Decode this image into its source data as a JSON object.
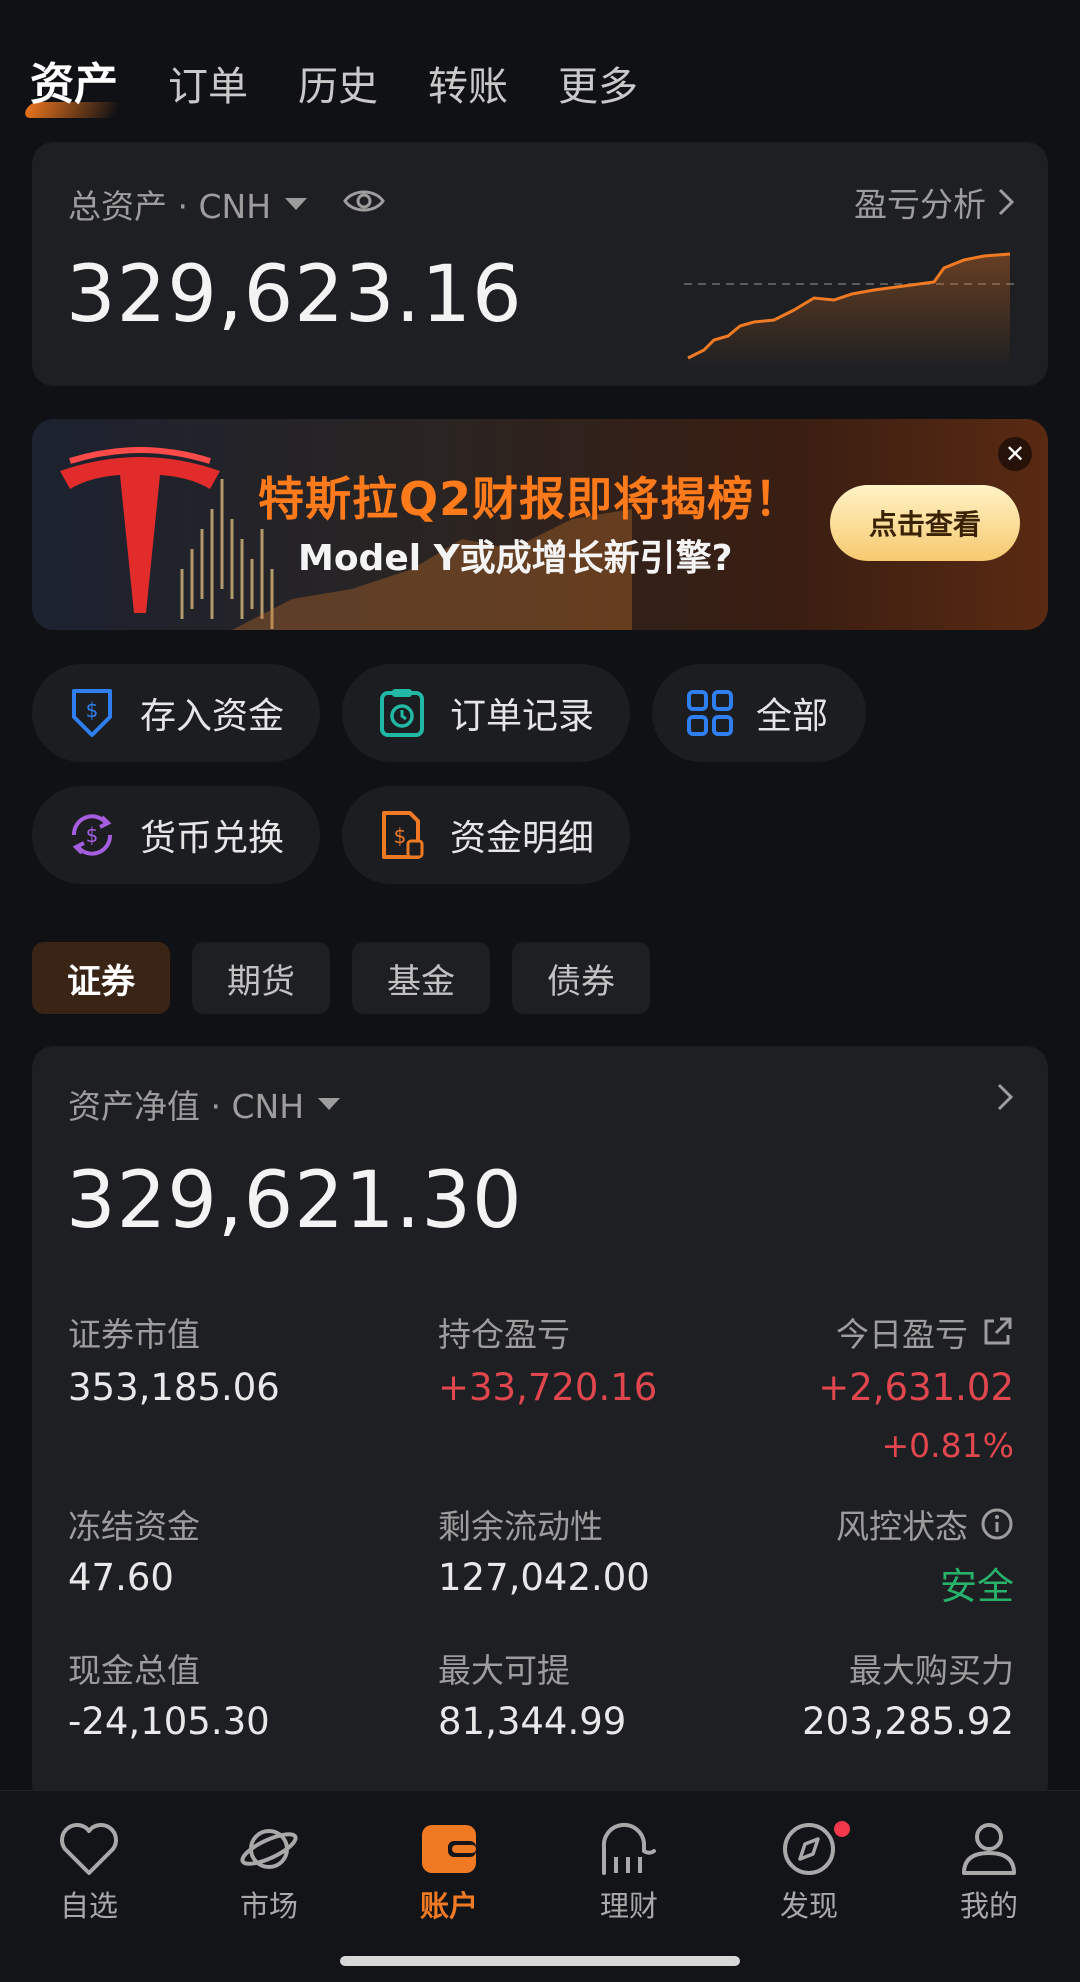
{
  "top_tabs": [
    "资产",
    "订单",
    "历史",
    "转账",
    "更多"
  ],
  "total": {
    "label": "总资产 · CNH",
    "value": "329,623.16",
    "pnl_link": "盈亏分析",
    "sparkline_color": "#f07a24"
  },
  "banner": {
    "title": "特斯拉Q2财报即将揭榜！",
    "subtitle": "Model Y或成增长新引擎?",
    "button": "点击查看"
  },
  "quick_actions": [
    {
      "label": "存入资金",
      "icon": "deposit-icon",
      "color": "#2f7ff0"
    },
    {
      "label": "订单记录",
      "icon": "order-record-icon",
      "color": "#21b8a5"
    },
    {
      "label": "全部",
      "icon": "grid-icon",
      "color": "#2f7ff0"
    },
    {
      "label": "货币兑换",
      "icon": "currency-exchange-icon",
      "color": "#a65ee0"
    },
    {
      "label": "资金明细",
      "icon": "fund-detail-icon",
      "color": "#f07a24"
    }
  ],
  "segments": [
    "证券",
    "期货",
    "基金",
    "债券"
  ],
  "net": {
    "label": "资产净值 · CNH",
    "value": "329,621.30",
    "stats": {
      "market_value": {
        "label": "证券市值",
        "value": "353,185.06"
      },
      "position_pnl": {
        "label": "持仓盈亏",
        "value": "+33,720.16"
      },
      "today_pnl": {
        "label": "今日盈亏",
        "value": "+2,631.02",
        "percent": "+0.81%"
      },
      "frozen": {
        "label": "冻结资金",
        "value": "47.60"
      },
      "liquidity": {
        "label": "剩余流动性",
        "value": "127,042.00"
      },
      "risk": {
        "label": "风控状态",
        "value": "安全"
      },
      "cash": {
        "label": "现金总值",
        "value": "-24,105.30"
      },
      "max_withdraw": {
        "label": "最大可提",
        "value": "81,344.99"
      },
      "max_buy": {
        "label": "最大购买力",
        "value": "203,285.92"
      }
    }
  },
  "bottom_nav": [
    "自选",
    "市场",
    "账户",
    "理财",
    "发现",
    "我的"
  ],
  "colors": {
    "accent": "#f07a24",
    "up": "#e0464e",
    "safe": "#27b26b"
  }
}
